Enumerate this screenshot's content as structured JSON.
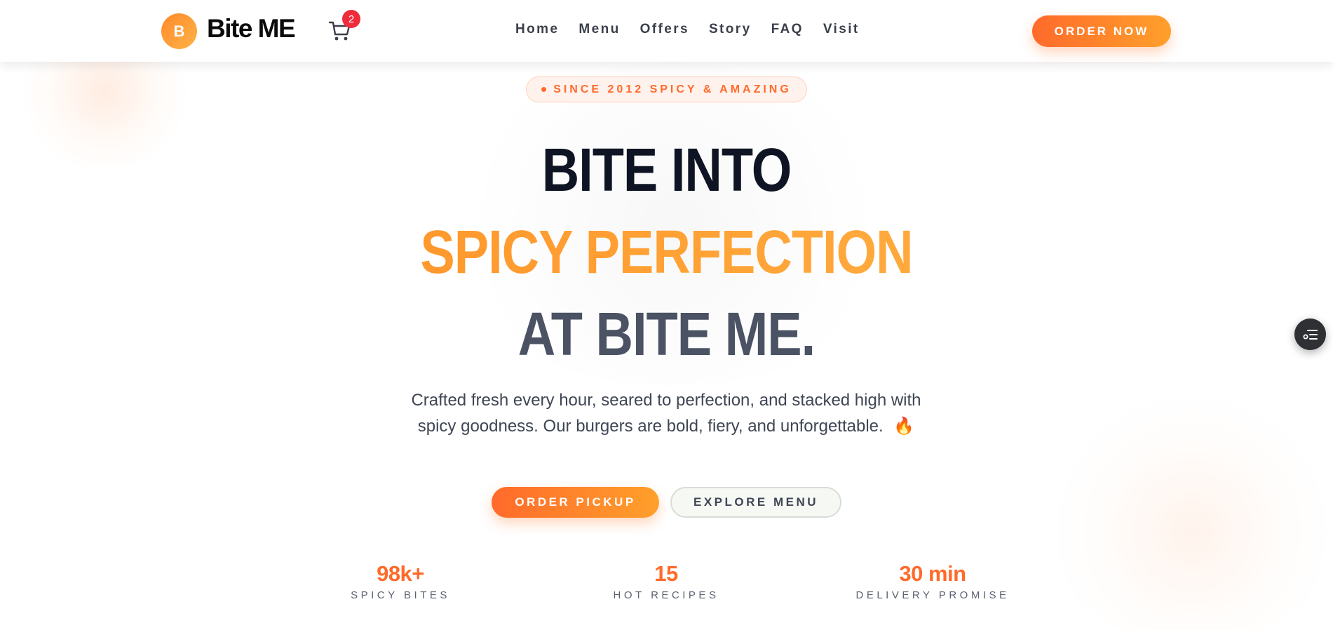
{
  "brand": {
    "badge_letter": "B",
    "name": "Bite ME"
  },
  "cart": {
    "count": "2"
  },
  "nav": {
    "items": [
      {
        "label": "Home"
      },
      {
        "label": "Menu"
      },
      {
        "label": "Offers"
      },
      {
        "label": "Story"
      },
      {
        "label": "FAQ"
      },
      {
        "label": "Visit"
      }
    ]
  },
  "header": {
    "order_now_label": "ORDER NOW"
  },
  "hero": {
    "pill_text": "SINCE 2012 SPICY & AMAZING",
    "headline_line1": "BITE INTO",
    "headline_line2": "SPICY PERFECTION",
    "headline_line3": "AT BITE ME.",
    "subtitle": "Crafted fresh every hour, seared to perfection, and stacked high with spicy goodness. Our burgers are bold, fiery, and unforgettable.",
    "subtitle_emoji": "🔥",
    "pickup_label": "ORDER PICKUP",
    "explore_label": "EXPLORE MENU"
  },
  "stats": [
    {
      "value": "98k+",
      "label": "SPICY BITES"
    },
    {
      "value": "15",
      "label": "HOT RECIPES"
    },
    {
      "value": "30 min",
      "label": "DELIVERY PROMISE"
    }
  ],
  "colors": {
    "accent": "#ff6a2b",
    "accent_light": "#ffa02b",
    "headline_dark": "#0f1424",
    "headline_gray": "#4a5263",
    "cart_badge": "#ef2b3c"
  },
  "icons": {
    "cart": "shopping-cart-icon",
    "floating": "list-settings-icon"
  }
}
